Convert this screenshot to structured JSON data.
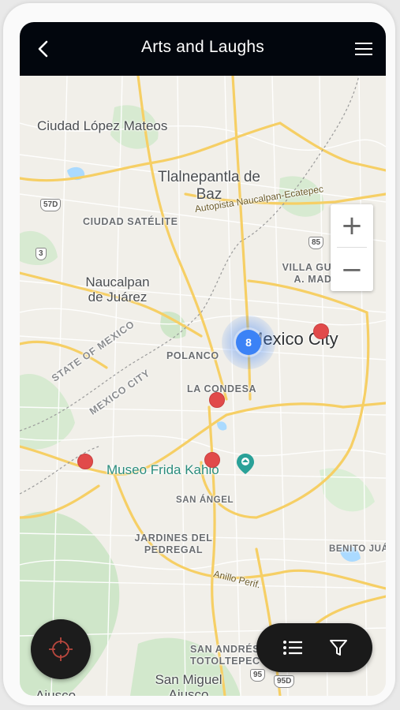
{
  "header": {
    "title": "Arts and Laughs"
  },
  "icons": {
    "back": "chevron-left-icon",
    "menu": "hamburger-menu-icon",
    "locate": "crosshair-icon",
    "list": "list-icon",
    "filter": "filter-icon"
  },
  "zoom": {
    "in_label": "+",
    "out_label": "−"
  },
  "cluster": {
    "count": "8"
  },
  "map_labels": {
    "ciudad_lopez_mateos": "Ciudad López Mateos",
    "tlalnepantla": "Tlalnepantla de Baz",
    "ciudad_satelite": "CIUDAD SATÉLITE",
    "autopista": "Autopista Naucalpan-Ecatepec",
    "villa_gustavo": "VILLA GUSTAVO A. MADERO",
    "naucalpan": "Naucalpan de Juárez",
    "polanco": "POLANCO",
    "mexico_city": "Mexico City",
    "state_of_mexico": "STATE OF MEXICO",
    "mexico_city_state": "MEXICO CITY",
    "la_condesa": "LA CONDESA",
    "museo_frida": "Museo Frida Kahlo",
    "san_angel": "SAN ÁNGEL",
    "jardines": "JARDINES DEL PEDREGAL",
    "benito_juarez": "BENITO JUÁ",
    "anillo": "Anillo Perif.",
    "san_andres": "SAN ANDRÉS TOTOLTEPEC",
    "san_miguel": "San Miguel Ajusco",
    "ajusco": "Ajusco",
    "hw_57d": "57D",
    "hw_3": "3",
    "hw_85": "85",
    "hw_95": "95",
    "hw_95d": "95D"
  },
  "colors": {
    "topbar": "#02060d",
    "pin": "#e14a4a",
    "cluster": "#3b82f6",
    "road_major": "#f6cf65",
    "park": "#c8e6c4"
  }
}
